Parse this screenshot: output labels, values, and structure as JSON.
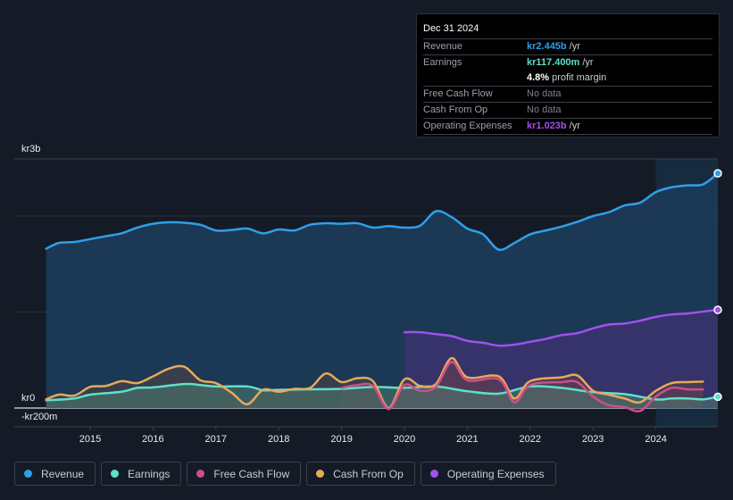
{
  "tooltip": {
    "date": "Dec 31 2024",
    "rows": [
      {
        "label": "Revenue",
        "value": "kr2.445b",
        "unit": "/yr",
        "color": "#2f9fe8"
      },
      {
        "label": "Earnings",
        "value": "kr117.400m",
        "unit": "/yr",
        "color": "#5fe0c8"
      },
      {
        "label": "",
        "margin_pct": "4.8%",
        "margin_text": "profit margin"
      },
      {
        "label": "Free Cash Flow",
        "nodata": "No data"
      },
      {
        "label": "Cash From Op",
        "nodata": "No data"
      },
      {
        "label": "Operating Expenses",
        "value": "kr1.023b",
        "unit": "/yr",
        "color": "#a24ff0"
      }
    ]
  },
  "legend": [
    {
      "label": "Revenue",
      "color": "#2f9fe8"
    },
    {
      "label": "Earnings",
      "color": "#5fe0c8"
    },
    {
      "label": "Free Cash Flow",
      "color": "#cf4e8a"
    },
    {
      "label": "Cash From Op",
      "color": "#e8a85c"
    },
    {
      "label": "Operating Expenses",
      "color": "#a24ff0"
    }
  ],
  "chart_data": {
    "type": "area",
    "title": "",
    "xlabel": "",
    "ylabel": "",
    "y_unit": "kr millions",
    "ylim": [
      -200,
      3000
    ],
    "xlim": [
      2014.3,
      2025.0
    ],
    "y_axis_labels": [
      {
        "value": 3000,
        "label": "kr3b"
      },
      {
        "value": 0,
        "label": "kr0"
      },
      {
        "value": -200,
        "label": "-kr200m"
      }
    ],
    "gridlines": [
      1000,
      2000
    ],
    "x_ticks": [
      2015,
      2016,
      2017,
      2018,
      2019,
      2020,
      2021,
      2022,
      2023,
      2024
    ],
    "highlight_from": 2024.0,
    "series": [
      {
        "name": "Revenue",
        "color": "#2f9fe8",
        "x": [
          2014.3,
          2014.5,
          2014.75,
          2015.0,
          2015.25,
          2015.5,
          2015.75,
          2016.0,
          2016.25,
          2016.5,
          2016.75,
          2017.0,
          2017.25,
          2017.5,
          2017.75,
          2018.0,
          2018.25,
          2018.5,
          2018.75,
          2019.0,
          2019.25,
          2019.5,
          2019.75,
          2020.0,
          2020.25,
          2020.5,
          2020.75,
          2021.0,
          2021.25,
          2021.5,
          2021.75,
          2022.0,
          2022.25,
          2022.5,
          2022.75,
          2023.0,
          2023.25,
          2023.5,
          2023.75,
          2024.0,
          2024.25,
          2024.5,
          2024.75,
          2025.0
        ],
        "values": [
          1660,
          1720,
          1730,
          1760,
          1790,
          1820,
          1880,
          1920,
          1935,
          1930,
          1910,
          1850,
          1855,
          1870,
          1820,
          1860,
          1850,
          1910,
          1925,
          1920,
          1925,
          1880,
          1895,
          1880,
          1900,
          2050,
          1990,
          1870,
          1810,
          1650,
          1720,
          1810,
          1850,
          1890,
          1940,
          2000,
          2040,
          2110,
          2140,
          2250,
          2300,
          2320,
          2330,
          2445
        ]
      },
      {
        "name": "Earnings",
        "color": "#5fe0c8",
        "x": [
          2014.3,
          2014.75,
          2015.0,
          2015.5,
          2015.75,
          2016.0,
          2016.5,
          2016.75,
          2017.0,
          2017.5,
          2017.75,
          2018.0,
          2018.5,
          2019.0,
          2019.5,
          2020.0,
          2020.5,
          2021.0,
          2021.5,
          2022.0,
          2022.5,
          2023.0,
          2023.5,
          2024.0,
          2024.25,
          2024.5,
          2024.75,
          2025.0
        ],
        "values": [
          80,
          100,
          140,
          170,
          210,
          215,
          250,
          240,
          225,
          225,
          185,
          190,
          195,
          200,
          220,
          210,
          225,
          175,
          150,
          225,
          210,
          165,
          145,
          90,
          100,
          100,
          90,
          117
        ]
      },
      {
        "name": "Free Cash Flow",
        "color": "#cf4e8a",
        "x": [
          2019.0,
          2019.25,
          2019.5,
          2019.75,
          2020.0,
          2020.25,
          2020.5,
          2020.75,
          2021.0,
          2021.5,
          2021.75,
          2022.0,
          2022.5,
          2022.75,
          2023.0,
          2023.25,
          2023.5,
          2023.75,
          2024.0,
          2024.25,
          2024.5,
          2024.75
        ],
        "values": [
          210,
          240,
          230,
          -10,
          240,
          180,
          220,
          480,
          290,
          300,
          60,
          240,
          270,
          270,
          120,
          30,
          10,
          -30,
          120,
          210,
          195,
          195
        ]
      },
      {
        "name": "Cash From Op",
        "color": "#e8a85c",
        "x": [
          2014.3,
          2014.5,
          2014.75,
          2015.0,
          2015.25,
          2015.5,
          2015.75,
          2016.0,
          2016.25,
          2016.5,
          2016.75,
          2017.0,
          2017.25,
          2017.5,
          2017.75,
          2018.0,
          2018.25,
          2018.5,
          2018.75,
          2019.0,
          2019.25,
          2019.5,
          2019.75,
          2020.0,
          2020.25,
          2020.5,
          2020.75,
          2021.0,
          2021.5,
          2021.75,
          2022.0,
          2022.5,
          2022.75,
          2023.0,
          2023.25,
          2023.5,
          2023.75,
          2024.0,
          2024.25,
          2024.5,
          2024.75
        ],
        "values": [
          90,
          140,
          130,
          220,
          230,
          280,
          260,
          330,
          410,
          430,
          290,
          260,
          160,
          40,
          190,
          170,
          200,
          210,
          360,
          270,
          310,
          280,
          0,
          300,
          230,
          250,
          520,
          320,
          330,
          100,
          280,
          320,
          340,
          180,
          140,
          100,
          60,
          180,
          260,
          270,
          275
        ]
      },
      {
        "name": "Operating Expenses",
        "color": "#a24ff0",
        "x": [
          2020.0,
          2020.25,
          2020.5,
          2020.75,
          2021.0,
          2021.25,
          2021.5,
          2021.75,
          2022.0,
          2022.25,
          2022.5,
          2022.75,
          2023.0,
          2023.25,
          2023.5,
          2023.75,
          2024.0,
          2024.25,
          2024.5,
          2024.75,
          2025.0
        ],
        "values": [
          790,
          790,
          770,
          750,
          700,
          680,
          650,
          660,
          690,
          720,
          760,
          780,
          830,
          870,
          880,
          910,
          950,
          975,
          985,
          1005,
          1023
        ]
      }
    ]
  }
}
